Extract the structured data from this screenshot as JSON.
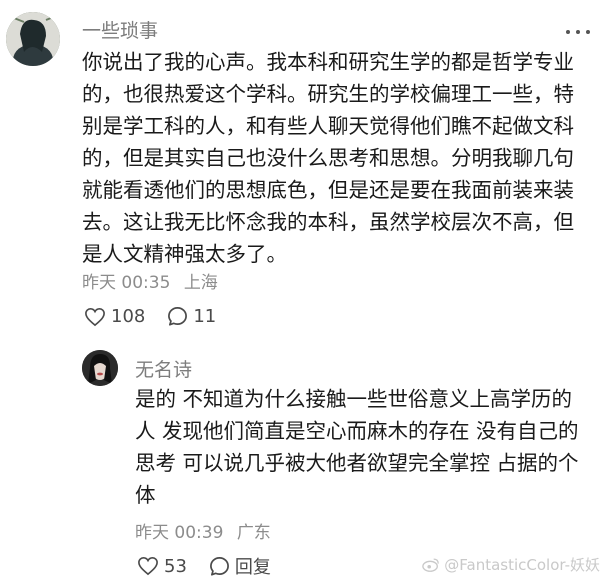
{
  "main_comment": {
    "username": "一些琐事",
    "lines": [
      "你说出了我的心声。我本科和研究生学的都是哲学专业",
      "的，也很热爱这个学科。研究生的学校偏理工一些，特",
      "别是学工科的人，和有些人聊天觉得他们瞧不起做文科",
      "的，但是其实自己也没什么思考和思想。分明我聊几句",
      "就能看透他们的思想底色，但是还是要在我面前装来装",
      "去。这让我无比怀念我的本科，虽然学校层次不高，但",
      "是人文精神强太多了。"
    ],
    "time": "昨天 00:35",
    "location": "上海",
    "likes": "108",
    "comments": "11"
  },
  "reply": {
    "username": "无名诗",
    "lines": [
      "是的 不知道为什么接触一些世俗意义上高学历的",
      "人 发现他们简直是空心而麻木的存在 没有自己的",
      "思考 可以说几乎被大他者欲望完全掌控 占据的个",
      "体"
    ],
    "time": "昨天 00:39",
    "location": "广东",
    "likes": "53",
    "reply_label": "回复"
  },
  "watermark": "@FantasticColor-妖妖",
  "icons": {
    "more": "more-icon",
    "like": "heart-icon",
    "comment": "comment-icon"
  }
}
